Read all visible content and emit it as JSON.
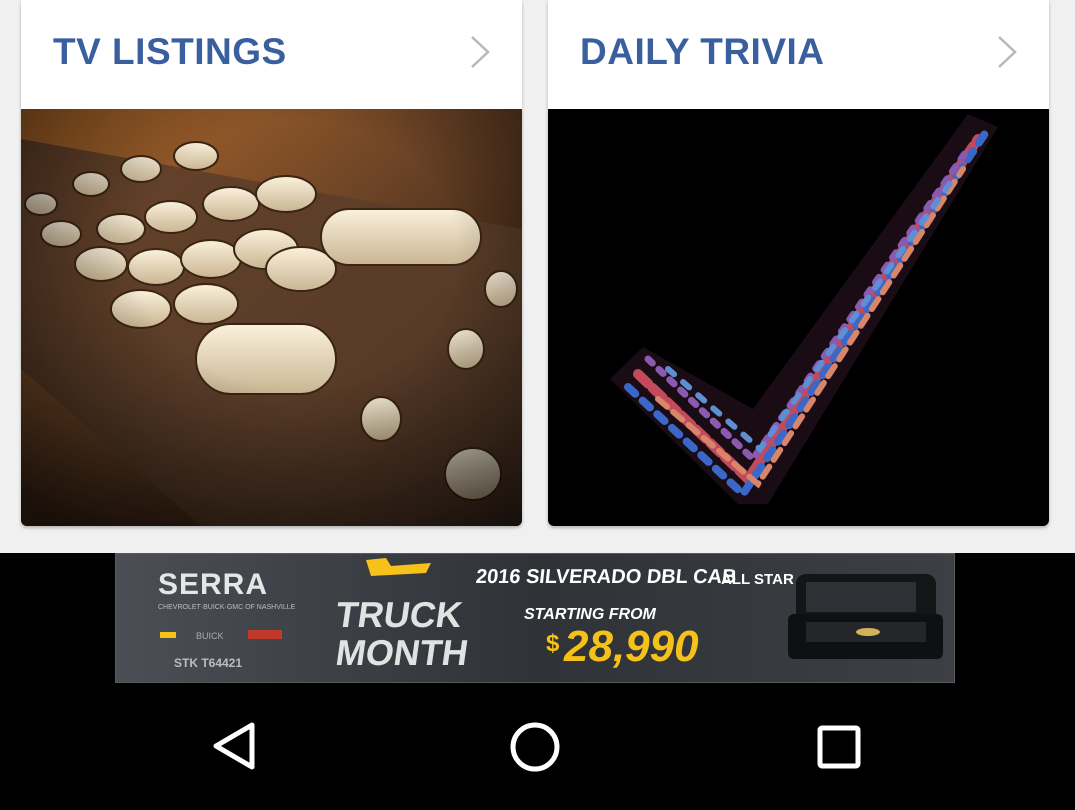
{
  "cards": [
    {
      "title": "TV LISTINGS",
      "icon": "chevron-right-icon",
      "image": "tv-remote-photo"
    },
    {
      "title": "DAILY TRIVIA",
      "icon": "chevron-right-icon",
      "image": "daily-trivia-checkmark-wordcloud"
    }
  ],
  "ad": {
    "brand": "SERRA",
    "brand_sub": "CHEVROLET·BUICK·GMC OF NASHVILLE",
    "headline_1": "TRUCK",
    "headline_2": "MONTH",
    "model": "2016 SILVERADO DBL CAB",
    "trim": "ALL STAR",
    "starting": "STARTING FROM",
    "price": "28,990",
    "currency": "$",
    "stock": "STK T64421",
    "accent_color": "#f6c21a"
  },
  "navbar": {
    "back": "back-icon",
    "home": "home-icon",
    "recents": "recents-icon"
  },
  "colors": {
    "title": "#3a5f9e",
    "chevron": "#b8b8b8",
    "nav_icon": "#ffffff"
  }
}
